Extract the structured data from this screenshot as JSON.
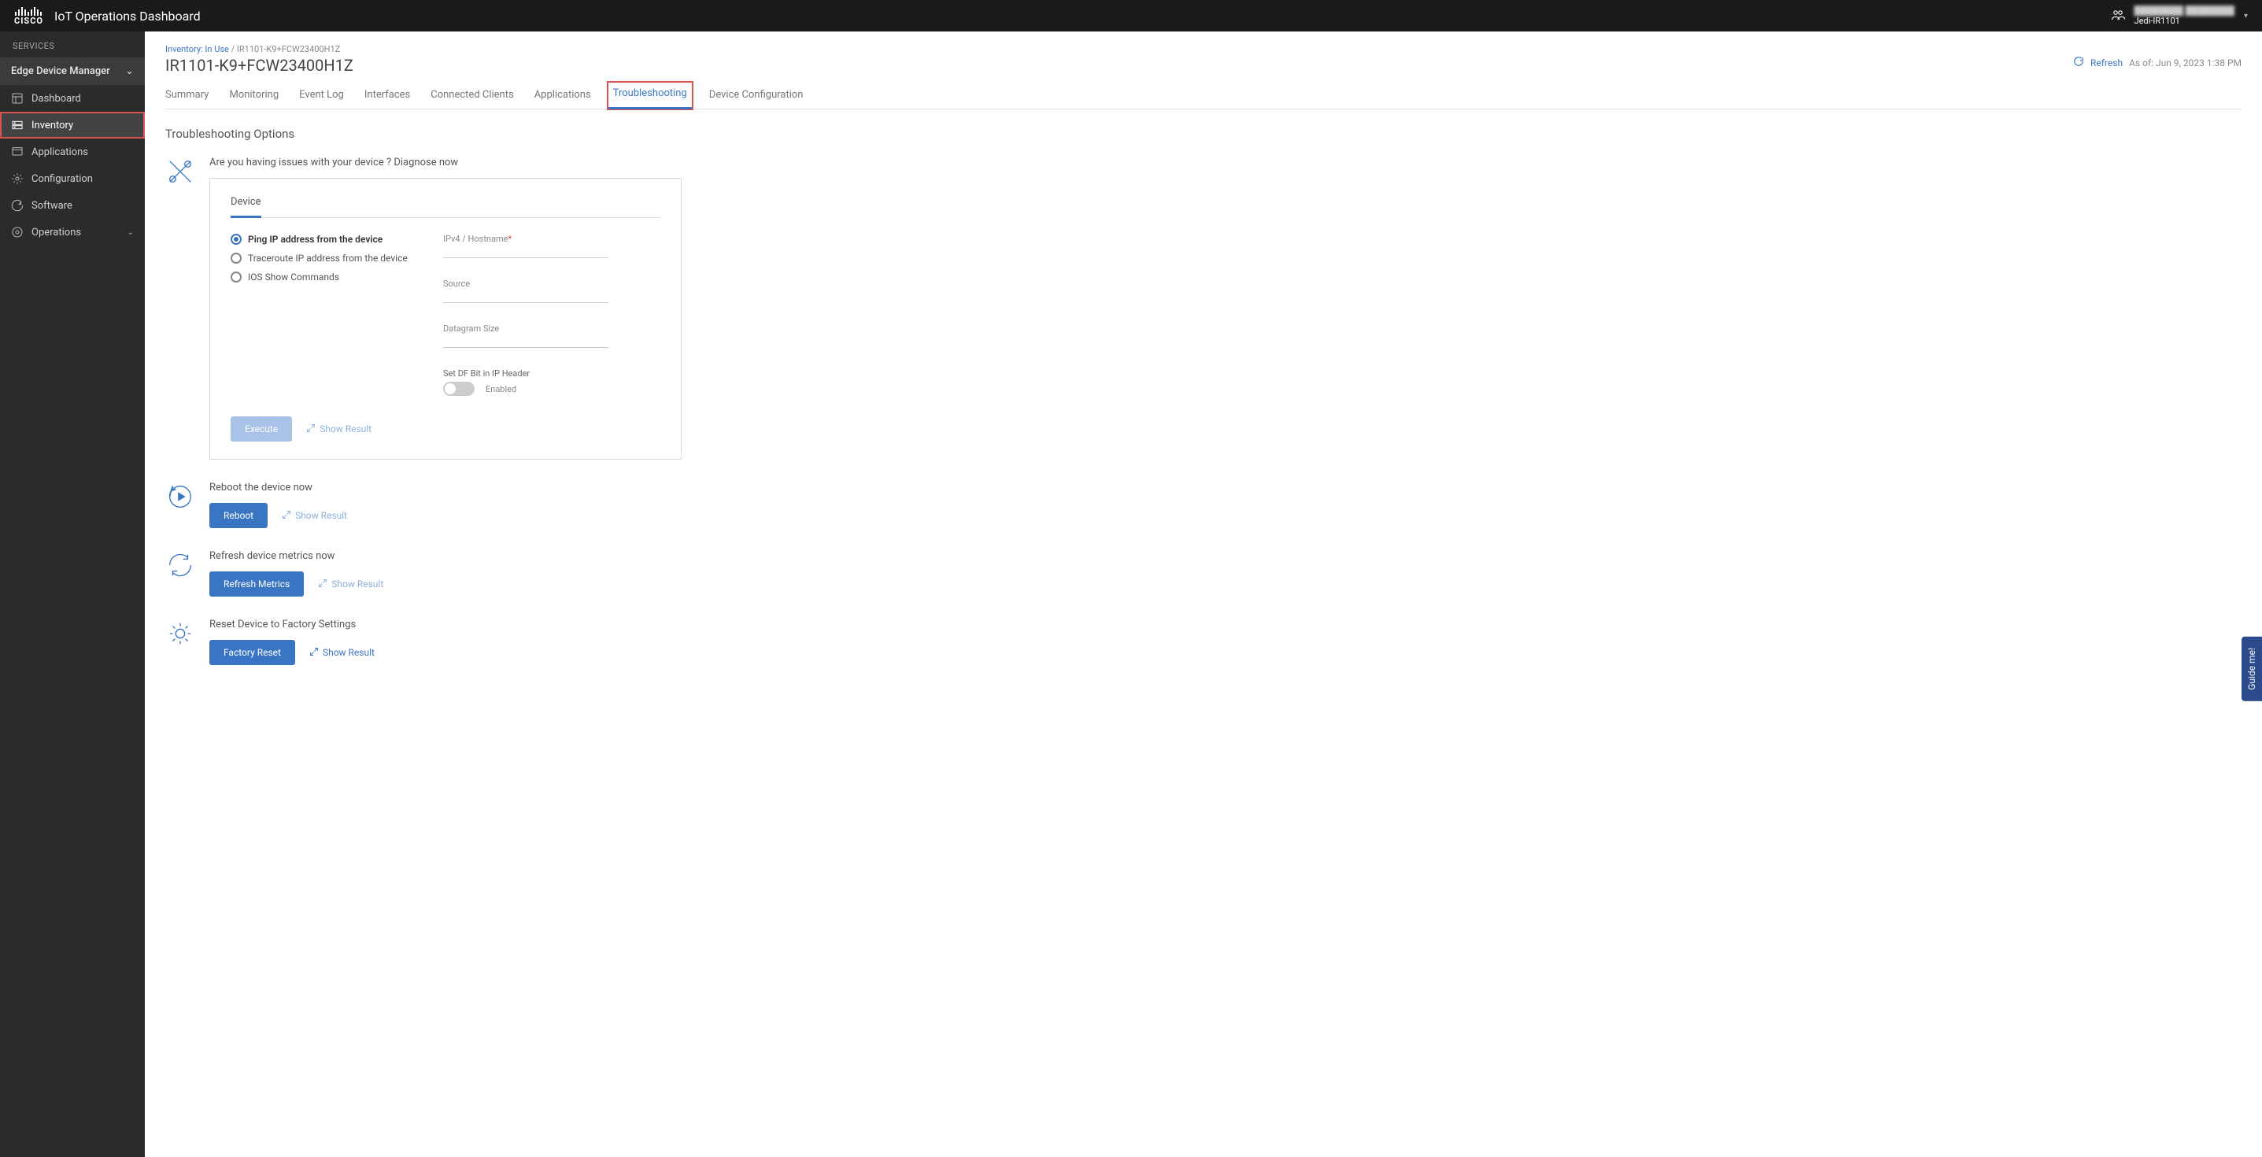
{
  "header": {
    "app_title": "IoT Operations Dashboard",
    "org_name": "████████ ████████",
    "org_sub": "Jedi-IR1101"
  },
  "sidebar": {
    "services_label": "SERVICES",
    "section": "Edge Device Manager",
    "items": [
      {
        "label": "Dashboard"
      },
      {
        "label": "Inventory"
      },
      {
        "label": "Applications"
      },
      {
        "label": "Configuration"
      },
      {
        "label": "Software"
      },
      {
        "label": "Operations"
      }
    ]
  },
  "breadcrumb": {
    "a": "Inventory: In Use",
    "b": "IR1101-K9+FCW23400H1Z"
  },
  "page_title": "IR1101-K9+FCW23400H1Z",
  "refresh": {
    "label": "Refresh",
    "timestamp": "As of: Jun 9, 2023 1:38 PM"
  },
  "tabs": [
    "Summary",
    "Monitoring",
    "Event Log",
    "Interfaces",
    "Connected Clients",
    "Applications",
    "Troubleshooting",
    "Device Configuration"
  ],
  "section_title": "Troubleshooting Options",
  "diagnose": {
    "prompt": "Are you having issues with your device ? Diagnose now",
    "card_tab": "Device",
    "radios": [
      "Ping IP address from the device",
      "Traceroute IP address from the device",
      "IOS Show Commands"
    ],
    "fields": {
      "ip_label": "IPv4 / Hostname",
      "source_label": "Source",
      "datagram_label": "Datagram Size",
      "df_label": "Set DF Bit in IP Header",
      "enabled_label": "Enabled"
    },
    "execute_btn": "Execute",
    "show_result": "Show Result"
  },
  "reboot": {
    "prompt": "Reboot the device now",
    "btn": "Reboot",
    "show_result": "Show Result"
  },
  "metrics": {
    "prompt": "Refresh device metrics now",
    "btn": "Refresh Metrics",
    "show_result": "Show Result"
  },
  "factory": {
    "prompt": "Reset Device to Factory Settings",
    "btn": "Factory Reset",
    "show_result": "Show Result"
  },
  "guide": "Guide me!"
}
